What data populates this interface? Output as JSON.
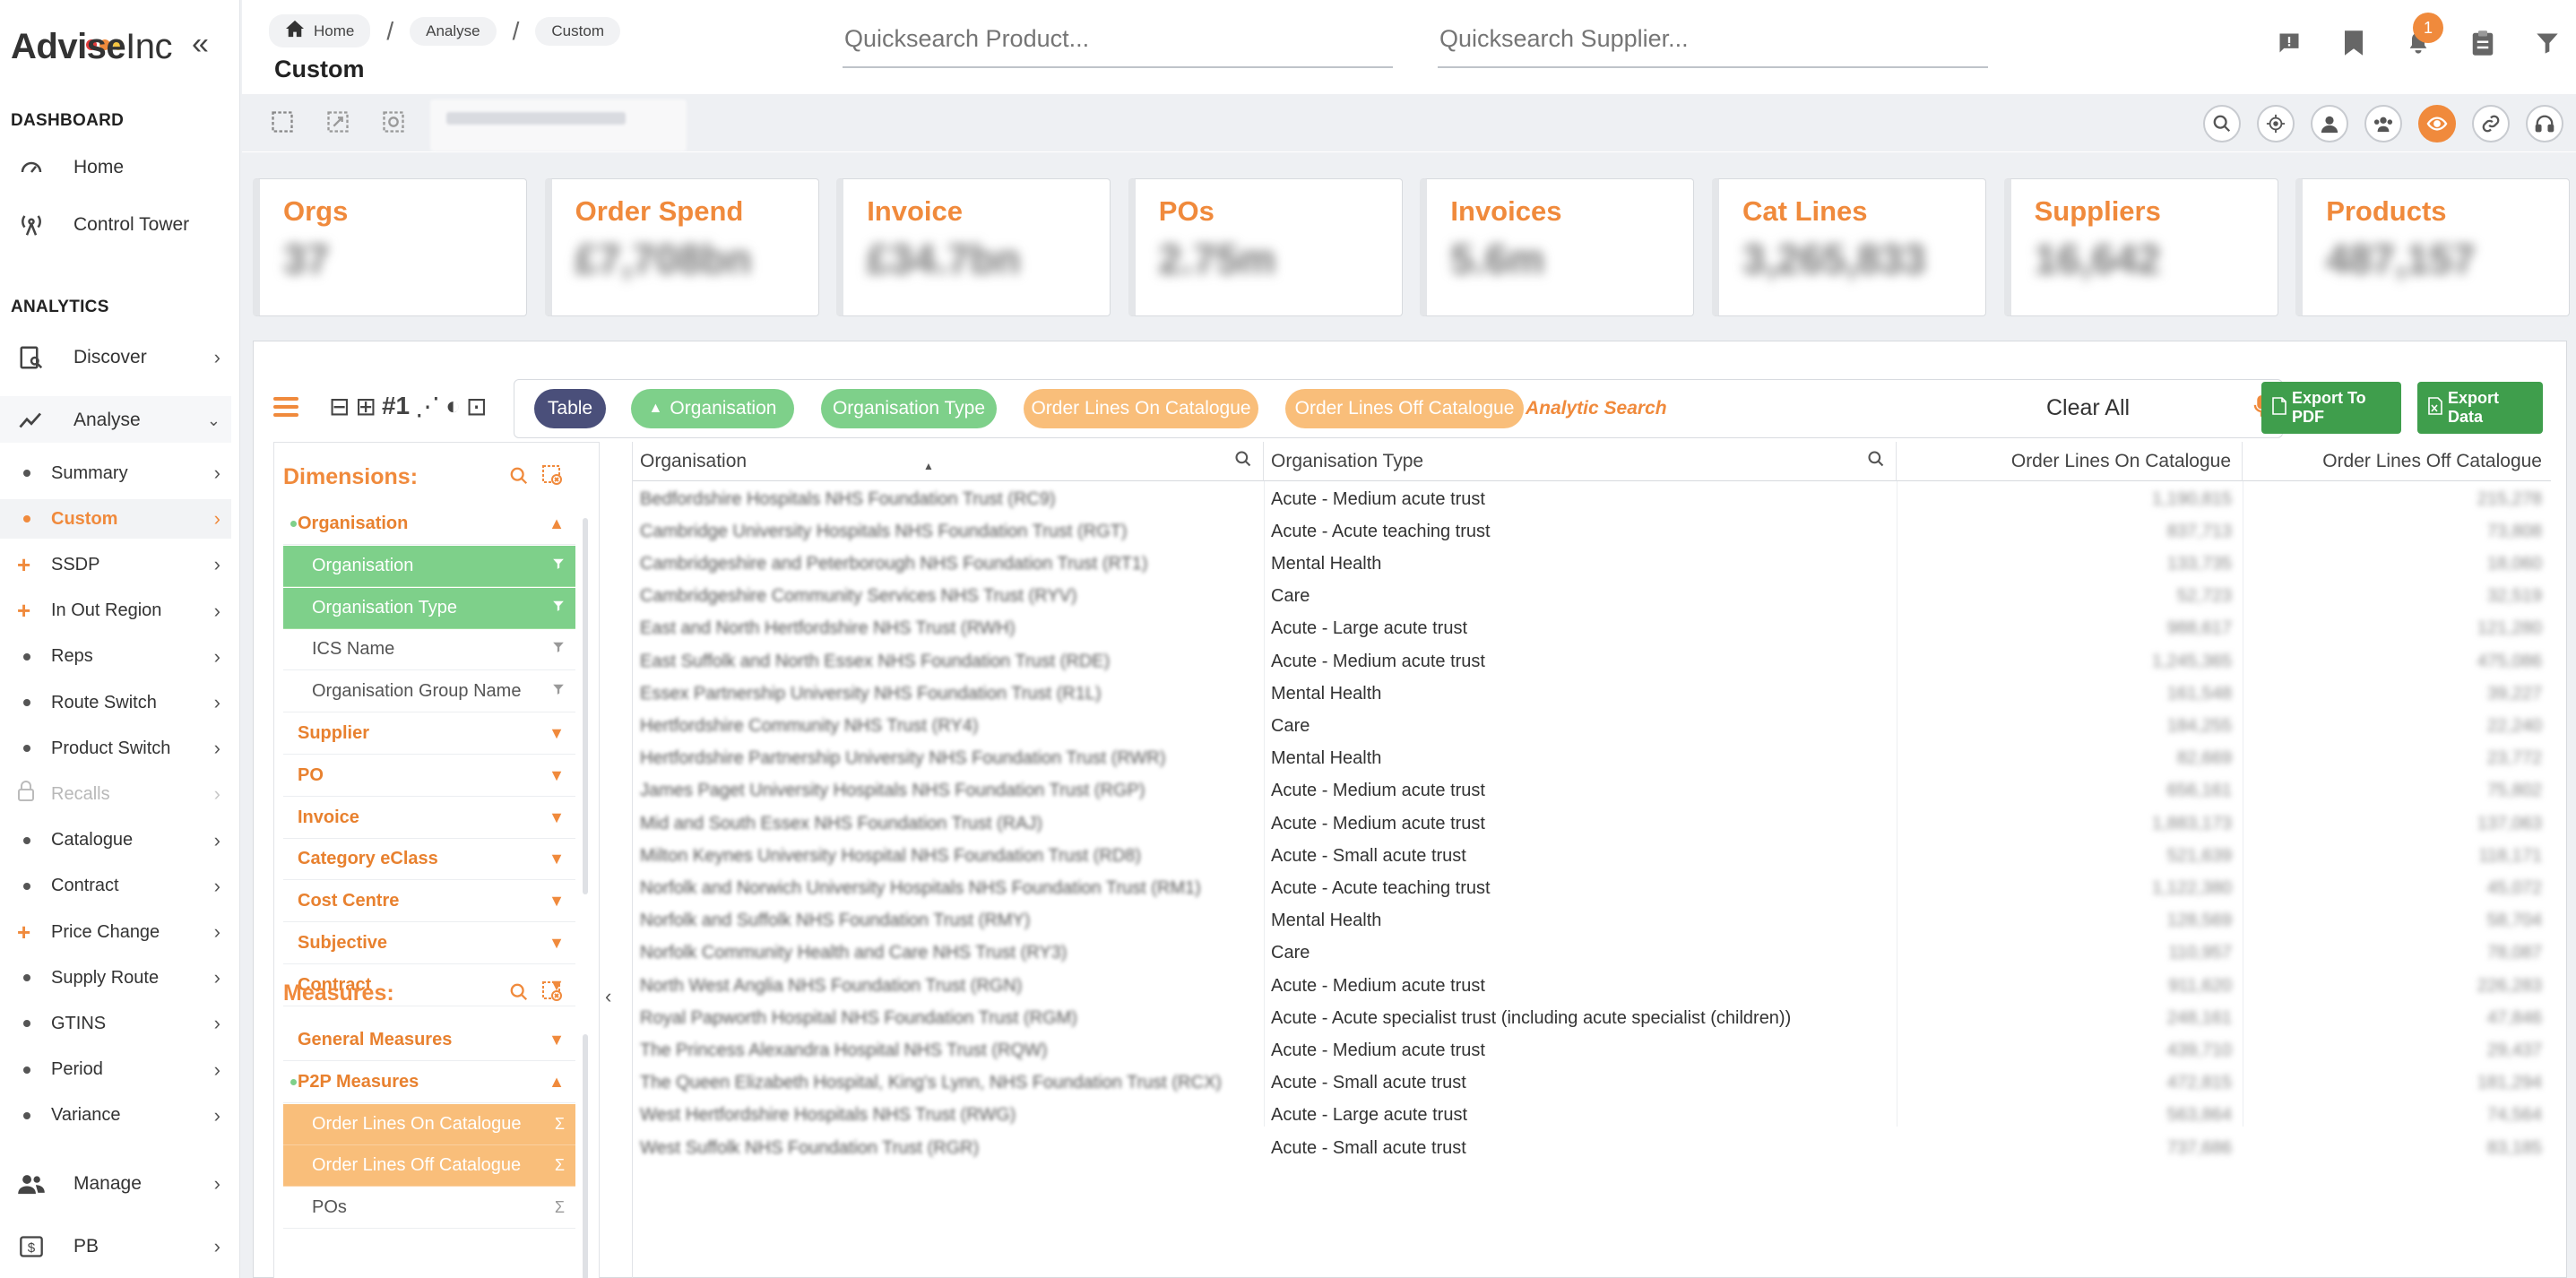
{
  "brand": {
    "name_bold": "Advise",
    "name_light": "Inc",
    "dot_colors": [
      "#e23b3b",
      "#f08a3c",
      "#f5c542"
    ]
  },
  "sidebar": {
    "dashboard_label": "DASHBOARD",
    "dashboard_items": [
      {
        "label": "Home",
        "icon": "gauge-icon"
      },
      {
        "label": "Control Tower",
        "icon": "tower-icon"
      }
    ],
    "analytics_label": "ANALYTICS",
    "discover": "Discover",
    "analyse": "Analyse",
    "analyse_items": [
      {
        "label": "Summary",
        "marker": "dot"
      },
      {
        "label": "Custom",
        "marker": "dot",
        "active": true
      },
      {
        "label": "SSDP",
        "marker": "plus"
      },
      {
        "label": "In Out Region",
        "marker": "plus"
      },
      {
        "label": "Reps",
        "marker": "dot"
      },
      {
        "label": "Route Switch",
        "marker": "dot"
      },
      {
        "label": "Product Switch",
        "marker": "dot"
      },
      {
        "label": "Recalls",
        "marker": "lock",
        "disabled": true
      },
      {
        "label": "Catalogue",
        "marker": "dot"
      },
      {
        "label": "Contract",
        "marker": "dot"
      },
      {
        "label": "Price Change",
        "marker": "plus"
      },
      {
        "label": "Supply Route",
        "marker": "dot"
      },
      {
        "label": "GTINS",
        "marker": "dot"
      },
      {
        "label": "Period",
        "marker": "dot"
      },
      {
        "label": "Variance",
        "marker": "dot"
      }
    ],
    "manage": "Manage",
    "pb": "PB"
  },
  "header": {
    "breadcrumbs": [
      "Home",
      "Analyse",
      "Custom"
    ],
    "title": "Custom",
    "product_search_placeholder": "Quicksearch Product...",
    "supplier_search_placeholder": "Quicksearch Supplier...",
    "notification_count": "1",
    "accent": "#f08a3c"
  },
  "kpis": [
    {
      "title": "Orgs",
      "value": "37"
    },
    {
      "title": "Order Spend",
      "value": "£7,708bn"
    },
    {
      "title": "Invoice",
      "value": "£34.7bn"
    },
    {
      "title": "POs",
      "value": "2.75m"
    },
    {
      "title": "Invoices",
      "value": "5.6m"
    },
    {
      "title": "Cat Lines",
      "value": "3,265,833"
    },
    {
      "title": "Suppliers",
      "value": "16,642"
    },
    {
      "title": "Products",
      "value": "487,157"
    }
  ],
  "toolbar": {
    "chips": [
      {
        "label": "Table",
        "style": "dark"
      },
      {
        "label": "Organisation",
        "style": "green",
        "sorted": true
      },
      {
        "label": "Organisation Type",
        "style": "green"
      },
      {
        "label": "Order Lines On Catalogue",
        "style": "orange"
      },
      {
        "label": "Order Lines Off Catalogue",
        "style": "orange"
      }
    ],
    "analytic_search": "Analytic Search",
    "clear_all": "Clear All",
    "export_pdf": "Export To PDF",
    "export_data": "Export Data"
  },
  "dimensions": {
    "title": "Dimensions:",
    "rows": [
      {
        "label": "Organisation",
        "kind": "cat-open"
      },
      {
        "label": "Organisation",
        "kind": "green"
      },
      {
        "label": "Organisation Type",
        "kind": "green"
      },
      {
        "label": "ICS Name",
        "kind": "sub"
      },
      {
        "label": "Organisation Group Name",
        "kind": "sub"
      },
      {
        "label": "Supplier",
        "kind": "cat"
      },
      {
        "label": "PO",
        "kind": "cat"
      },
      {
        "label": "Invoice",
        "kind": "cat"
      },
      {
        "label": "Category eClass",
        "kind": "cat"
      },
      {
        "label": "Cost Centre",
        "kind": "cat"
      },
      {
        "label": "Subjective",
        "kind": "cat"
      },
      {
        "label": "Contract",
        "kind": "cat"
      }
    ]
  },
  "measures": {
    "title": "Measures:",
    "rows": [
      {
        "label": "General Measures",
        "kind": "cat"
      },
      {
        "label": "P2P Measures",
        "kind": "cat-open"
      },
      {
        "label": "Order Lines On Catalogue",
        "kind": "orange"
      },
      {
        "label": "Order Lines Off Catalogue",
        "kind": "orange"
      },
      {
        "label": "POs",
        "kind": "sub"
      }
    ]
  },
  "table": {
    "columns": [
      "Organisation",
      "Organisation Type",
      "Order Lines On Catalogue",
      "Order Lines Off Catalogue"
    ],
    "rows": [
      [
        "Bedfordshire Hospitals NHS Foundation Trust (RC9)",
        "Acute - Medium acute trust",
        "1,190,815",
        "215,278"
      ],
      [
        "Cambridge University Hospitals NHS Foundation Trust (RGT)",
        "Acute - Acute teaching trust",
        "837,713",
        "73,808"
      ],
      [
        "Cambridgeshire and Peterborough NHS Foundation Trust (RT1)",
        "Mental Health",
        "133,735",
        "18,060"
      ],
      [
        "Cambridgeshire Community Services NHS Trust (RYV)",
        "Care",
        "52,723",
        "32,519"
      ],
      [
        "East and North Hertfordshire NHS Trust (RWH)",
        "Acute - Large acute trust",
        "988,617",
        "121,280"
      ],
      [
        "East Suffolk and North Essex NHS Foundation Trust (RDE)",
        "Acute - Medium acute trust",
        "1,245,365",
        "475,086"
      ],
      [
        "Essex Partnership University NHS Foundation Trust (R1L)",
        "Mental Health",
        "161,548",
        "39,227"
      ],
      [
        "Hertfordshire Community NHS Trust (RY4)",
        "Care",
        "184,255",
        "22,240"
      ],
      [
        "Hertfordshire Partnership University NHS Foundation Trust (RWR)",
        "Mental Health",
        "82,669",
        "23,772"
      ],
      [
        "James Paget University Hospitals NHS Foundation Trust (RGP)",
        "Acute - Medium acute trust",
        "656,161",
        "75,802"
      ],
      [
        "Mid and South Essex NHS Foundation Trust (RAJ)",
        "Acute - Medium acute trust",
        "1,883,173",
        "137,063"
      ],
      [
        "Milton Keynes University Hospital NHS Foundation Trust (RD8)",
        "Acute - Small acute trust",
        "521,639",
        "118,171"
      ],
      [
        "Norfolk and Norwich University Hospitals NHS Foundation Trust (RM1)",
        "Acute - Acute teaching trust",
        "1,122,380",
        "45,072"
      ],
      [
        "Norfolk and Suffolk NHS Foundation Trust (RMY)",
        "Mental Health",
        "128,569",
        "58,704"
      ],
      [
        "Norfolk Community Health and Care NHS Trust (RY3)",
        "Care",
        "110,957",
        "78,087"
      ],
      [
        "North West Anglia NHS Foundation Trust (RGN)",
        "Acute - Medium acute trust",
        "911,620",
        "226,283"
      ],
      [
        "Royal Papworth Hospital NHS Foundation Trust (RGM)",
        "Acute - Acute specialist trust (including acute specialist (children))",
        "248,161",
        "47,846"
      ],
      [
        "The Princess Alexandra Hospital NHS Trust (RQW)",
        "Acute - Medium acute trust",
        "439,710",
        "29,437"
      ],
      [
        "The Queen Elizabeth Hospital, King's Lynn, NHS Foundation Trust (RCX)",
        "Acute - Small acute trust",
        "472,815",
        "181,294"
      ],
      [
        "West Hertfordshire Hospitals NHS Trust (RWG)",
        "Acute - Large acute trust",
        "563,864",
        "74,564"
      ],
      [
        "West Suffolk NHS Foundation Trust (RGR)",
        "Acute - Small acute trust",
        "737,686",
        "83,185"
      ]
    ]
  }
}
